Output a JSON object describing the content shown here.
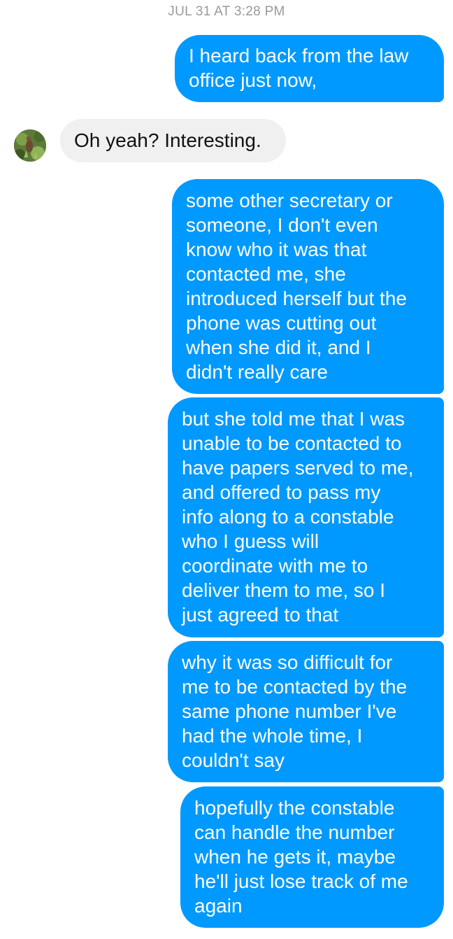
{
  "conversation": {
    "timestamp": "JUL 31 AT 3:28 PM",
    "messages": [
      {
        "sender": "me",
        "text": "I heard back from the law\noffice just now,"
      },
      {
        "sender": "contact",
        "text": "Oh yeah? Interesting."
      },
      {
        "sender": "me",
        "text": "some other secretary or\nsomeone, I don't even\nknow who it was that\ncontacted me, she\nintroduced herself but the\nphone was cutting out\nwhen she did it, and I\ndidn't really care"
      },
      {
        "sender": "me",
        "text": "but she told me that I was\nunable to be contacted to\nhave papers served to me,\nand offered to pass my\ninfo along to a constable\nwho I guess will\ncoordinate with me to\ndeliver them to me, so I\njust agreed to that"
      },
      {
        "sender": "me",
        "text": "why it was so difficult for\nme to be contacted by the\nsame phone number I've\nhad the whole time, I\ncouldn't say"
      },
      {
        "sender": "me",
        "text": "hopefully the constable\ncan handle the number\nwhen he gets it, maybe\nhe'll just lose track of me\nagain"
      }
    ]
  },
  "contact": {
    "avatar_icon": "profile-photo-icon"
  },
  "colors": {
    "outgoing_bubble": "#0099ff",
    "incoming_bubble": "#f0f0f0",
    "timestamp_text": "#9a9a9a"
  }
}
